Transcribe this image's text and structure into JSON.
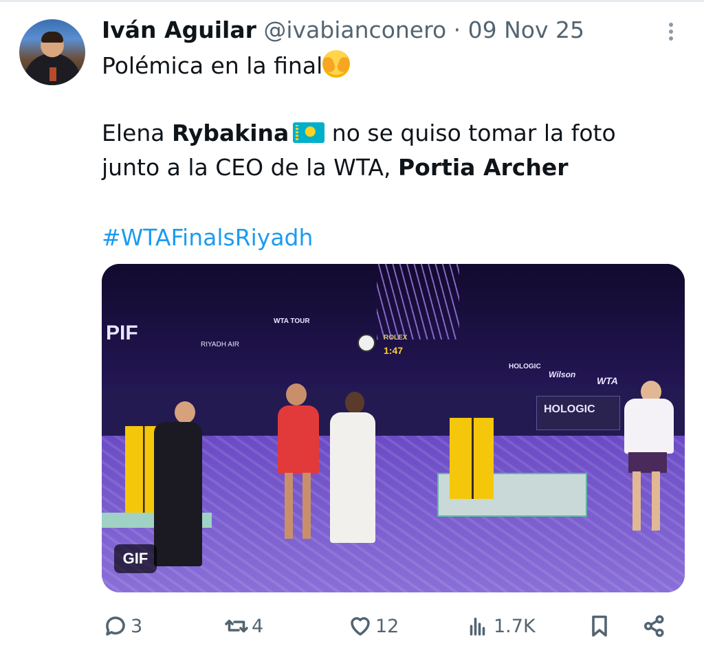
{
  "tweet": {
    "author_name": "Iván Aguilar",
    "handle": "@ivabianconero",
    "separator": "·",
    "date": "09 Nov 25",
    "line1": "Polémica en la final",
    "line2_prefix": "Elena ",
    "line2_bold": "Rybakina",
    "line2_suffix": " no se quiso tomar la foto",
    "line3_prefix": "junto a la CEO de la WTA, ",
    "line3_bold": "Portia Archer",
    "hashtag": "#WTAFinalsRiyadh",
    "emoji_1": "face-with-hand-over-eyes-icon",
    "emoji_2": "flag-kazakhstan-icon"
  },
  "media": {
    "badge": "GIF",
    "scene_text": {
      "sponsor_pif": "PIF",
      "sponsor_riyadh": "RIYADH AIR",
      "wta_tour": "WTA TOUR",
      "rolex": "ROLEX",
      "clock_time": "1:47",
      "hologic": "HOLOGIC",
      "wilson": "Wilson",
      "wta": "WTA"
    }
  },
  "actions": {
    "replies": "3",
    "retweets": "4",
    "likes": "12",
    "views": "1.7K"
  },
  "colors": {
    "link": "#1d9bf0",
    "secondary": "#536471",
    "primary": "#0f1419"
  }
}
